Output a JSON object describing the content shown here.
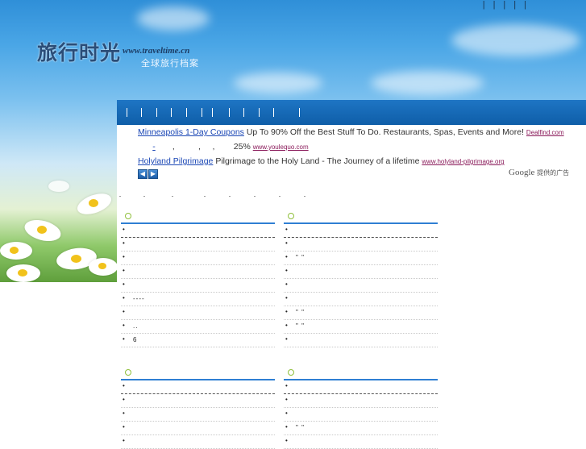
{
  "site": {
    "name_cn": "旅行时光",
    "url": "www.traveltime.cn",
    "subtitle": "全球旅行档案",
    "top_links": [
      "",
      "",
      "",
      "",
      ""
    ]
  },
  "nav": {
    "separator_count": 12
  },
  "ads": [
    {
      "title": "Minneapolis 1-Day Coupons",
      "text": "Up To 90% Off the Best Stuff To Do. Restaurants, Spas, Events and More!",
      "url": "Dealfind.com"
    },
    {
      "title": "-",
      "text": ",          ,     ,        25%",
      "url": "www.youlequo.com"
    },
    {
      "title": "Holyland Pilgrimage",
      "text": "Pilgrimage to the Holy Land - The Journey of a lifetime",
      "url": "www.holyland-pilgrimage.org"
    }
  ],
  "ad_footer": {
    "google": "Google",
    "label": "提供的广告"
  },
  "boxes": [
    {
      "rows": [
        "",
        "",
        "",
        "",
        "",
        "----",
        "",
        "..",
        "6"
      ]
    },
    {
      "rows": [
        "",
        "",
        "\" \"",
        "",
        "",
        "",
        "\" \"",
        "\" \"",
        ""
      ]
    },
    {
      "rows": [
        "",
        "",
        "",
        "",
        ""
      ]
    },
    {
      "rows": [
        "",
        "",
        "",
        "\" \"",
        ""
      ]
    }
  ],
  "colors": {
    "nav": "#0f5ea8",
    "accent_line": "#2f7fd3",
    "ad_link": "#1b47b5",
    "ad_url": "#8a1a5a"
  }
}
